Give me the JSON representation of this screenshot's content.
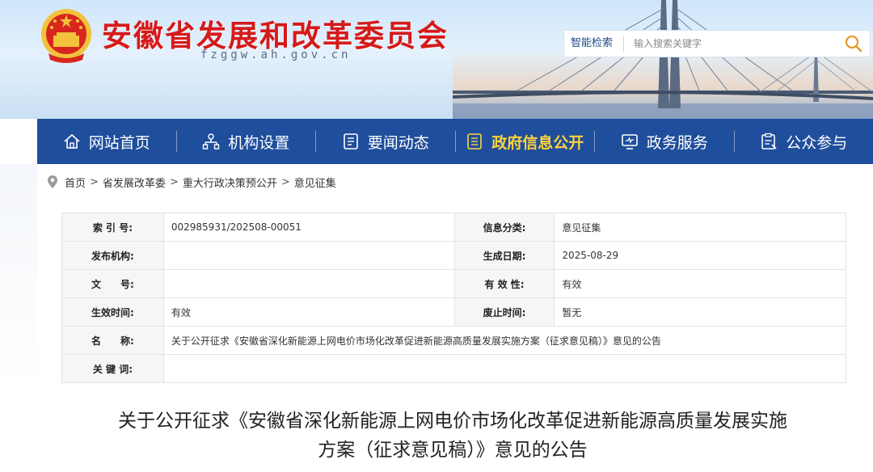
{
  "header": {
    "title": "安徽省发展和改革委员会",
    "domain": "fzggw.ah.gov.cn",
    "search_label": "智能检索",
    "search_placeholder": "输入搜索关键字"
  },
  "nav": {
    "items": [
      {
        "label": "网站首页",
        "icon": "home-icon"
      },
      {
        "label": "机构设置",
        "icon": "org-chart-icon"
      },
      {
        "label": "要闻动态",
        "icon": "news-icon"
      },
      {
        "label": "政府信息公开",
        "icon": "document-icon",
        "active": true
      },
      {
        "label": "政务服务",
        "icon": "monitor-icon"
      },
      {
        "label": "公众参与",
        "icon": "clipboard-icon"
      }
    ],
    "active_color": "#ffd43a",
    "bar_color": "#1f4e9c"
  },
  "breadcrumb": [
    "首页",
    "省发展改革委",
    "重大行政决策预公开",
    "意见征集"
  ],
  "info": {
    "r1": {
      "l1": "索 引 号:",
      "v1": "002985931/202508-00051",
      "l2": "信息分类:",
      "v2": "意见征集"
    },
    "r2": {
      "l1": "发布机构:",
      "v1": "",
      "l2": "生成日期:",
      "v2": "2025-08-29"
    },
    "r3": {
      "l1": "文　　号:",
      "v1": "",
      "l2": "有 效 性:",
      "v2": "有效"
    },
    "r4": {
      "l1": "生效时间:",
      "v1": "有效",
      "l2": "废止时间:",
      "v2": "暂无"
    },
    "r5": {
      "l1": "名　　称:",
      "v1": "关于公开征求《安徽省深化新能源上网电价市场化改革促进新能源高质量发展实施方案（征求意见稿）》意见的公告"
    },
    "r6": {
      "l1": "关 键 词:",
      "v1": ""
    }
  },
  "doc": {
    "title_line1": "关于公开征求《安徽省深化新能源上网电价市场化改革促进新能源高质量发展实施",
    "title_line2": "方案（征求意见稿）》意见的公告"
  }
}
